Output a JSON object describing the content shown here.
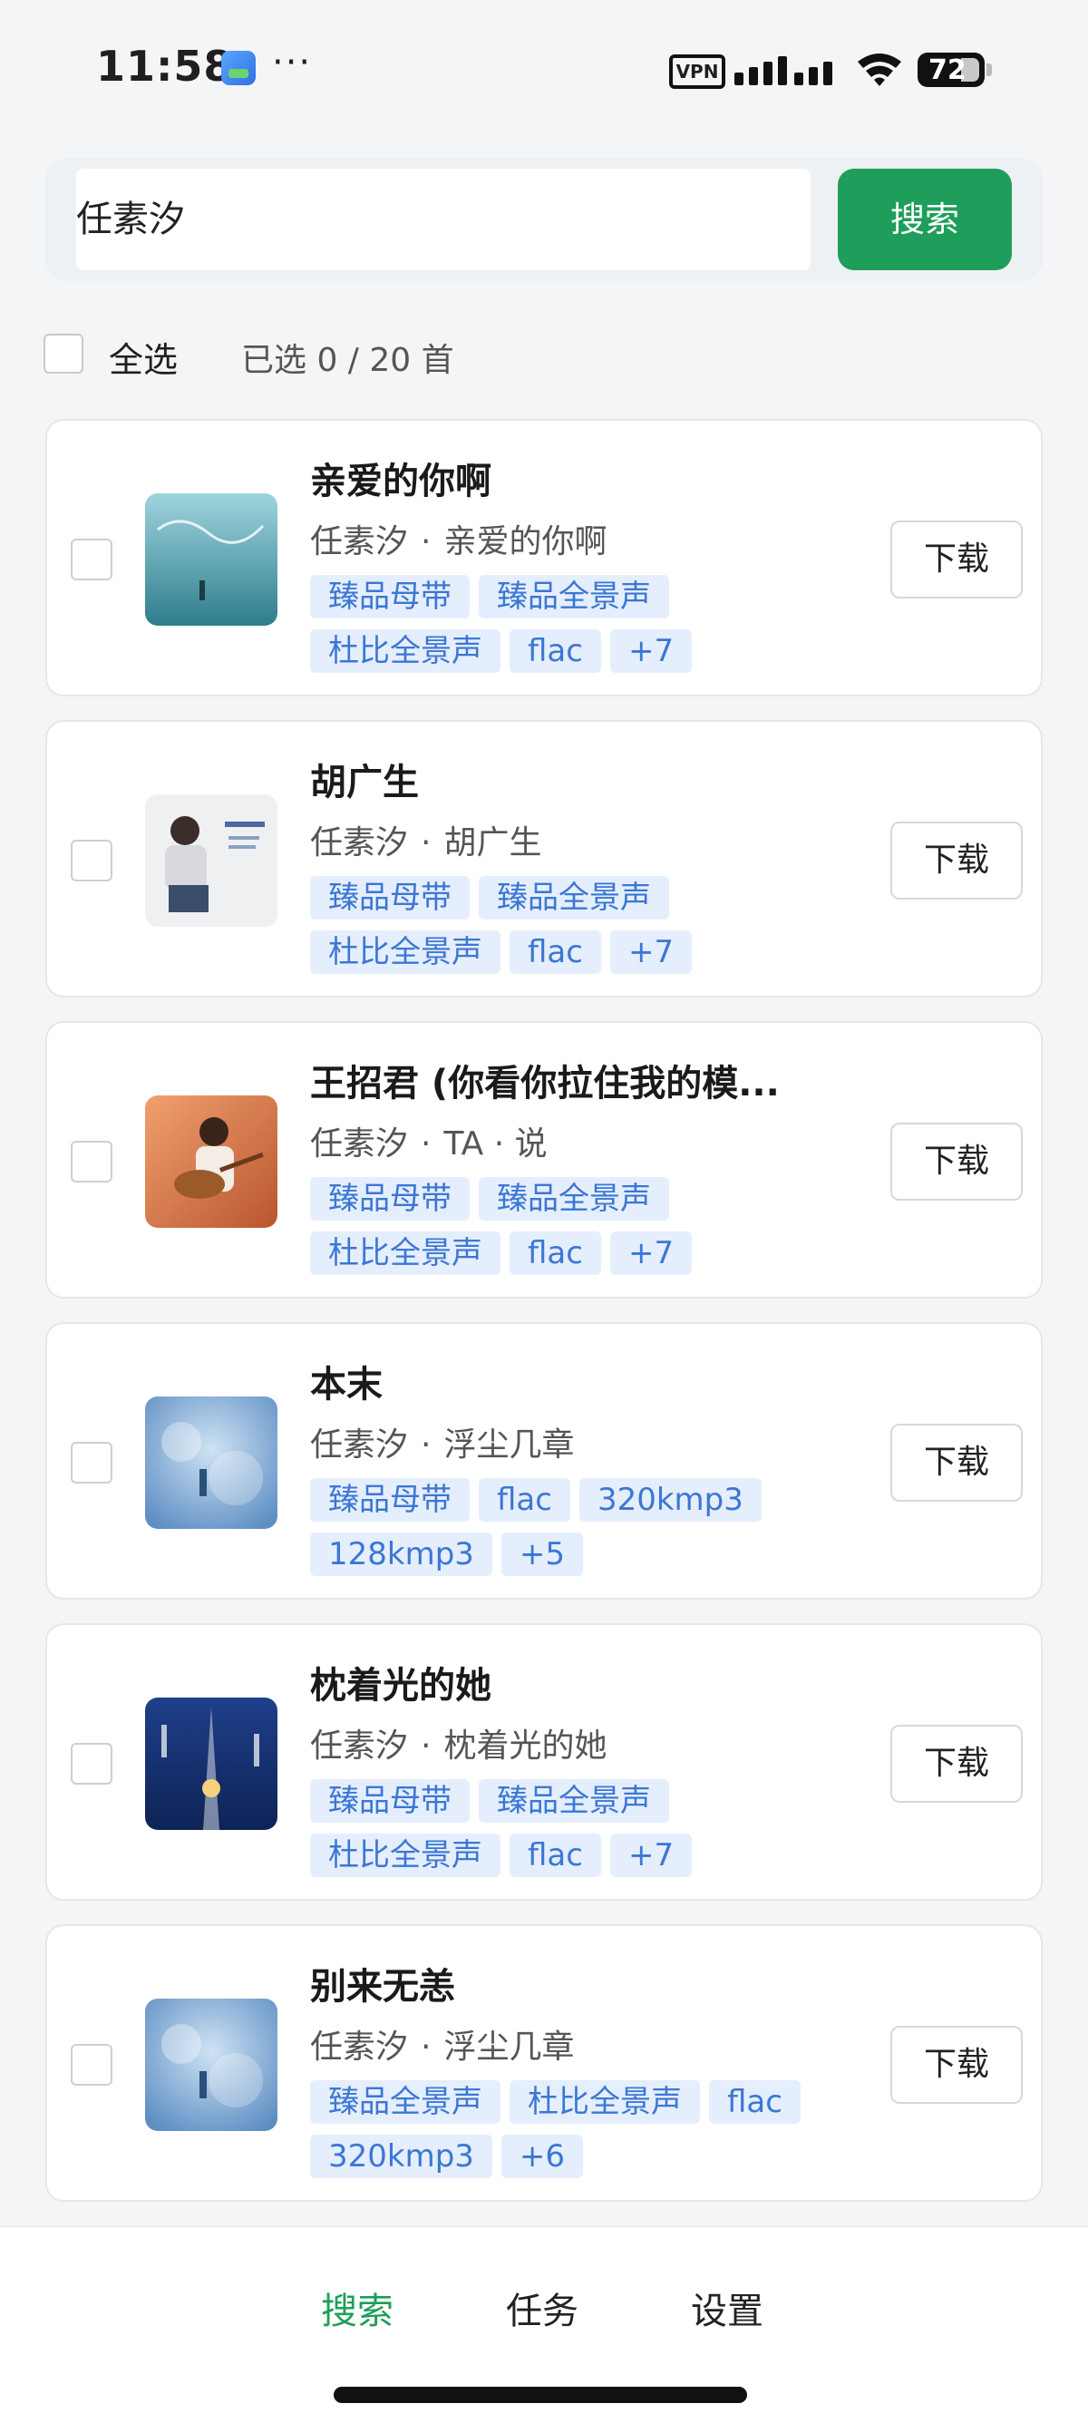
{
  "status_bar": {
    "time": "11:58",
    "more": "···",
    "vpn": "VPN",
    "battery": "72"
  },
  "search": {
    "query": "任素汐",
    "button": "搜索"
  },
  "selection": {
    "select_all": "全选",
    "count": "已选 0 / 20 首"
  },
  "songs": [
    {
      "title": "亲爱的你啊",
      "artist": "任素汐",
      "album": "亲爱的你啊",
      "tags": [
        "臻品母带",
        "臻品全景声",
        "杜比全景声",
        "flac",
        "+7"
      ],
      "button": "下载"
    },
    {
      "title": "胡广生",
      "artist": "任素汐",
      "album": "胡广生",
      "tags": [
        "臻品母带",
        "臻品全景声",
        "杜比全景声",
        "flac",
        "+7"
      ],
      "button": "下载"
    },
    {
      "title": "王招君 (你看你拉住我的模...",
      "artist": "任素汐",
      "album": "TA · 说",
      "tags": [
        "臻品母带",
        "臻品全景声",
        "杜比全景声",
        "flac",
        "+7"
      ],
      "button": "下载"
    },
    {
      "title": "本末",
      "artist": "任素汐",
      "album": "浮尘几章",
      "tags": [
        "臻品母带",
        "flac",
        "320kmp3",
        "128kmp3",
        "+5"
      ],
      "button": "下载"
    },
    {
      "title": "枕着光的她",
      "artist": "任素汐",
      "album": "枕着光的她",
      "tags": [
        "臻品母带",
        "臻品全景声",
        "杜比全景声",
        "flac",
        "+7"
      ],
      "button": "下载"
    },
    {
      "title": "别来无恙",
      "artist": "任素汐",
      "album": "浮尘几章",
      "tags": [
        "臻品全景声",
        "杜比全景声",
        "flac",
        "320kmp3",
        "+6"
      ],
      "button": "下载"
    }
  ],
  "nav": {
    "search": "搜索",
    "tasks": "任务",
    "settings": "设置",
    "active": "search"
  },
  "colors": {
    "accent": "#1e9e5a",
    "tag_bg": "#e5eefc",
    "tag_text": "#3b77d4"
  }
}
